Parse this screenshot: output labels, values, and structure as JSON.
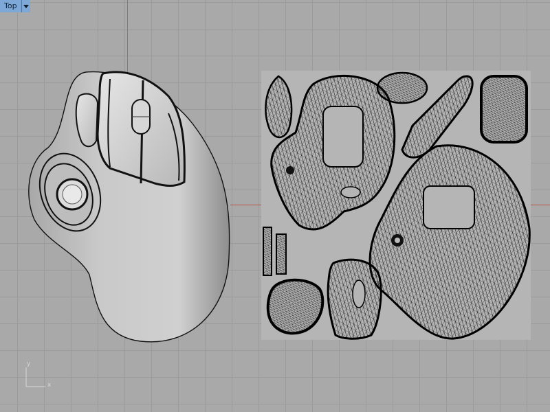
{
  "viewport": {
    "name": "Top",
    "menu_icon": "dropdown-arrow-icon"
  },
  "world_axes": {
    "x_label": "x",
    "y_label": "y"
  },
  "colors": {
    "background": "#a9a9a9",
    "grid": "#9b9b9b",
    "x_axis": "#c0392b",
    "y_axis": "#27ae60",
    "view_tab": "#7ea8d8",
    "uv_panel": "#b5b5b5"
  }
}
